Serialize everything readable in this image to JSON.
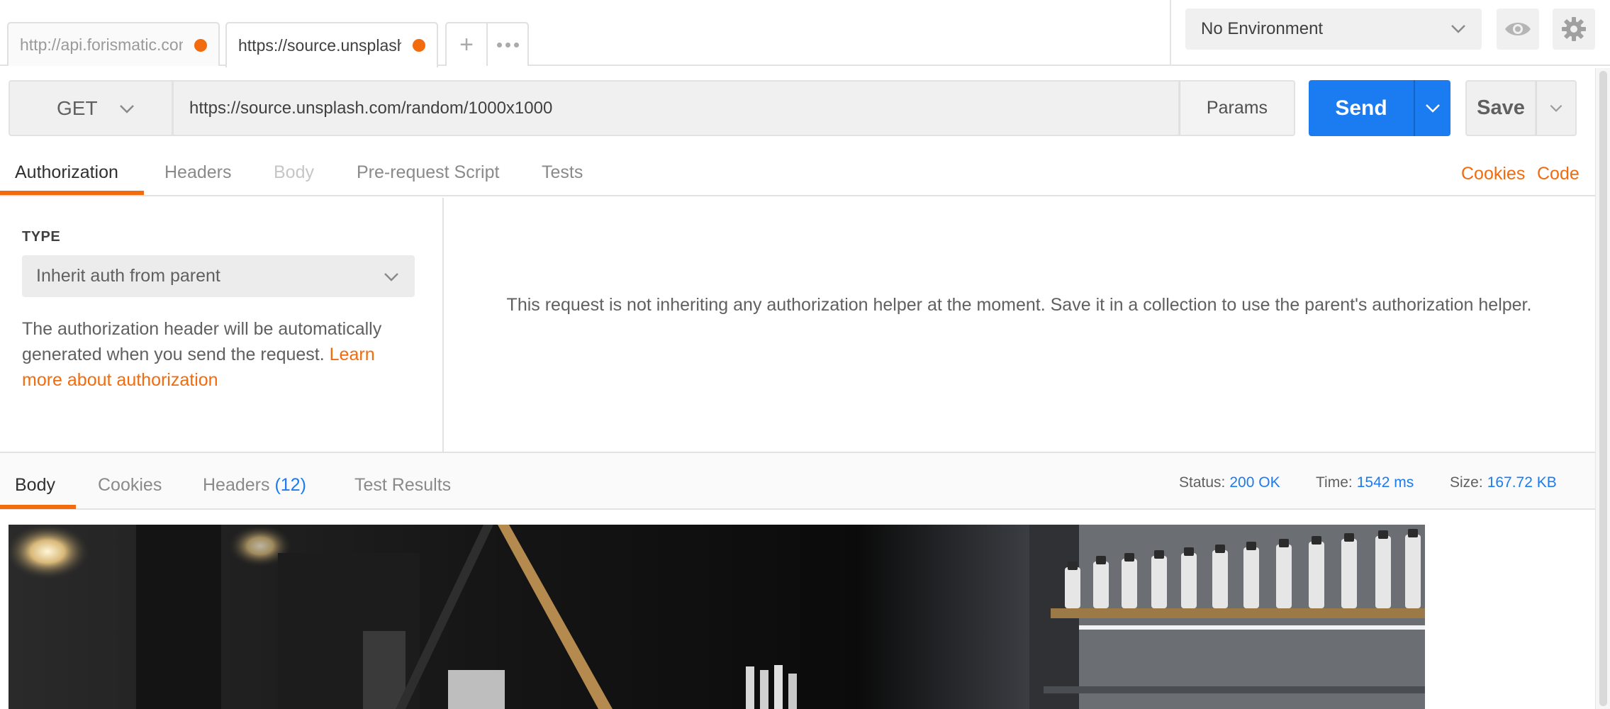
{
  "tabs": [
    {
      "label": "http://api.forismatic.com",
      "unsaved": true
    },
    {
      "label": "https://source.unsplash.com",
      "unsaved": true
    }
  ],
  "environment": {
    "selected": "No Environment"
  },
  "request": {
    "method": "GET",
    "url": "https://source.unsplash.com/random/1000x1000",
    "params_label": "Params",
    "send_label": "Send",
    "save_label": "Save"
  },
  "request_tabs": [
    "Authorization",
    "Headers",
    "Body",
    "Pre-request Script",
    "Tests"
  ],
  "request_links": {
    "cookies": "Cookies",
    "code": "Code"
  },
  "auth": {
    "type_label": "TYPE",
    "type_value": "Inherit auth from parent",
    "description": "The authorization header will be automatically generated when you send the request.",
    "learn_more": "Learn more about authorization",
    "message": "This request is not inheriting any authorization helper at the moment. Save it in a collection to use the parent's authorization helper."
  },
  "response": {
    "tabs": {
      "body": "Body",
      "cookies": "Cookies",
      "headers": "Headers",
      "headers_count": "(12)",
      "test_results": "Test Results"
    },
    "status_label": "Status:",
    "status": "200 OK",
    "time_label": "Time:",
    "time": "1542 ms",
    "size_label": "Size:",
    "size": "167.72 KB"
  },
  "colors": {
    "accent": "#f26b0f",
    "primary": "#1b7bf0"
  },
  "icons": [
    "unsaved-dot-icon",
    "plus-icon",
    "more-icon",
    "chevron-down-icon",
    "eye-icon",
    "gear-icon"
  ]
}
